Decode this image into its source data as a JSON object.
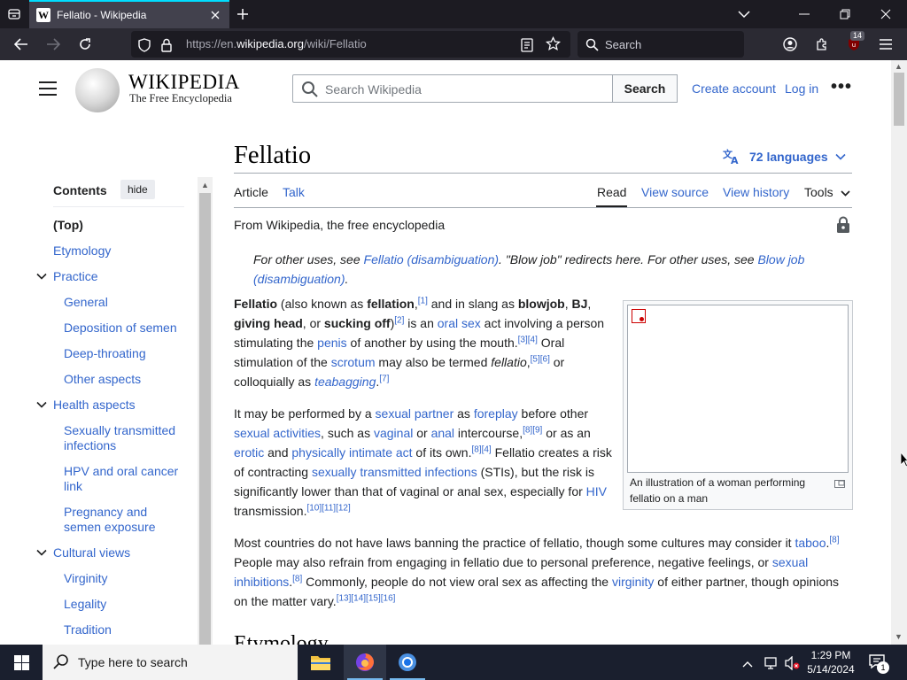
{
  "browser": {
    "tab": {
      "title": "Fellatio - Wikipedia",
      "favicon": "W"
    },
    "url": {
      "prefix": "https://en.",
      "domain": "wikipedia.org",
      "path": "/wiki/Fellatio"
    },
    "search_placeholder": "Search",
    "extension_badge": "14"
  },
  "wiki_header": {
    "wordmark": "WIKIPEDIA",
    "tagline": "The Free Encyclopedia",
    "search_placeholder": "Search Wikipedia",
    "search_button": "Search",
    "create_account": "Create account",
    "log_in": "Log in",
    "more": "•••"
  },
  "toc": {
    "title": "Contents",
    "hide_label": "hide",
    "items": [
      {
        "label": "(Top)"
      },
      {
        "label": "Etymology"
      },
      {
        "label": "Practice"
      },
      {
        "label": "General"
      },
      {
        "label": "Deposition of semen"
      },
      {
        "label": "Deep-throating"
      },
      {
        "label": "Other aspects"
      },
      {
        "label": "Health aspects"
      },
      {
        "label": "Sexually transmitted infections"
      },
      {
        "label": "HPV and oral cancer link"
      },
      {
        "label": "Pregnancy and semen exposure"
      },
      {
        "label": "Cultural views"
      },
      {
        "label": "Virginity"
      },
      {
        "label": "Legality"
      },
      {
        "label": "Tradition"
      }
    ]
  },
  "article": {
    "title": "Fellatio",
    "languages": "72 languages",
    "tabs": {
      "article": "Article",
      "talk": "Talk",
      "read": "Read",
      "view_source": "View source",
      "view_history": "View history",
      "tools": "Tools"
    },
    "from": "From Wikipedia, the free encyclopedia",
    "infobox_caption": "An illustration of a woman performing fellatio on a man",
    "next_heading": "Etymology"
  },
  "taskbar": {
    "search_placeholder": "Type here to search",
    "time": "1:29 PM",
    "date": "5/14/2024",
    "notification_count": "1"
  }
}
